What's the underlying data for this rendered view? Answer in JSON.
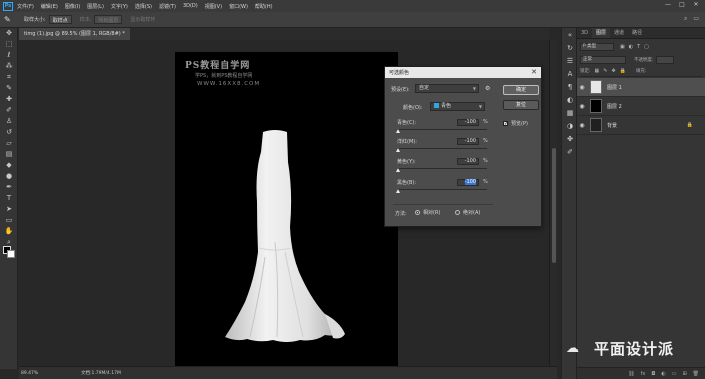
{
  "app": {
    "logo": "Ps"
  },
  "menu": [
    "文件(F)",
    "编辑(E)",
    "图像(I)",
    "图层(L)",
    "文字(Y)",
    "选择(S)",
    "滤镜(T)",
    "3D(D)",
    "视图(V)",
    "窗口(W)",
    "帮助(H)"
  ],
  "window_controls": [
    "—",
    "□",
    "✕"
  ],
  "options": {
    "sample_size_label": "取样大小:",
    "sample_size_value": "取样点",
    "sample_label": "样本:",
    "sample_value": "所有图层",
    "show_ring_label": "显示取样环"
  },
  "document": {
    "tab_title": "timg (1).jpg @ 89.5% (图层 1, RGB/8#) *",
    "watermark_title": "PS教程自学网",
    "watermark_sub": "学PS，就到PS教程自学网",
    "watermark_url": "WWW.16XX8.COM"
  },
  "status": {
    "zoom": "89.47%",
    "doc_info": "文档:1.79M/4.17M"
  },
  "panel": {
    "tabs": [
      "3D",
      "图层",
      "通道",
      "路径"
    ],
    "active_tab": "图层",
    "kind_label": "P 类型",
    "blend_mode": "正常",
    "opacity_label": "不透明度:",
    "lock_label": "锁定:",
    "fill_label": "填充:",
    "layers": [
      {
        "name": "图层 1",
        "thumb": "#e6e6e6",
        "selected": true
      },
      {
        "name": "图层 2",
        "thumb": "#000000",
        "selected": false
      },
      {
        "name": "背景",
        "thumb": "#202020",
        "selected": false,
        "locked": true
      }
    ]
  },
  "dialog": {
    "title": "可选颜色",
    "preset_label": "预设(E):",
    "preset_value": "自定",
    "colors_label": "颜色(O):",
    "colors_value": "青色",
    "colors_swatch": "#2fa7e0",
    "ok_label": "确定",
    "reset_label": "复位",
    "preview_label": "预览(P)",
    "preview_checked": true,
    "sliders": [
      {
        "label": "青色(C):",
        "value": "-100",
        "unit": "%",
        "position": 0
      },
      {
        "label": "洋红(M):",
        "value": "-100",
        "unit": "%",
        "position": 0
      },
      {
        "label": "黄色(Y):",
        "value": "-100",
        "unit": "%",
        "position": 0
      },
      {
        "label": "黑色(B):",
        "value": "-100",
        "unit": "%",
        "position": 0,
        "highlighted": true
      }
    ],
    "method_label": "方法:",
    "method_relative": "相对(R)",
    "method_absolute": "绝对(A)",
    "method_selected": "relative"
  },
  "wechat": {
    "text": "平面设计派"
  },
  "colors": {
    "accent": "#31a8ff",
    "foreground": "#000000",
    "background": "#ffffff"
  }
}
